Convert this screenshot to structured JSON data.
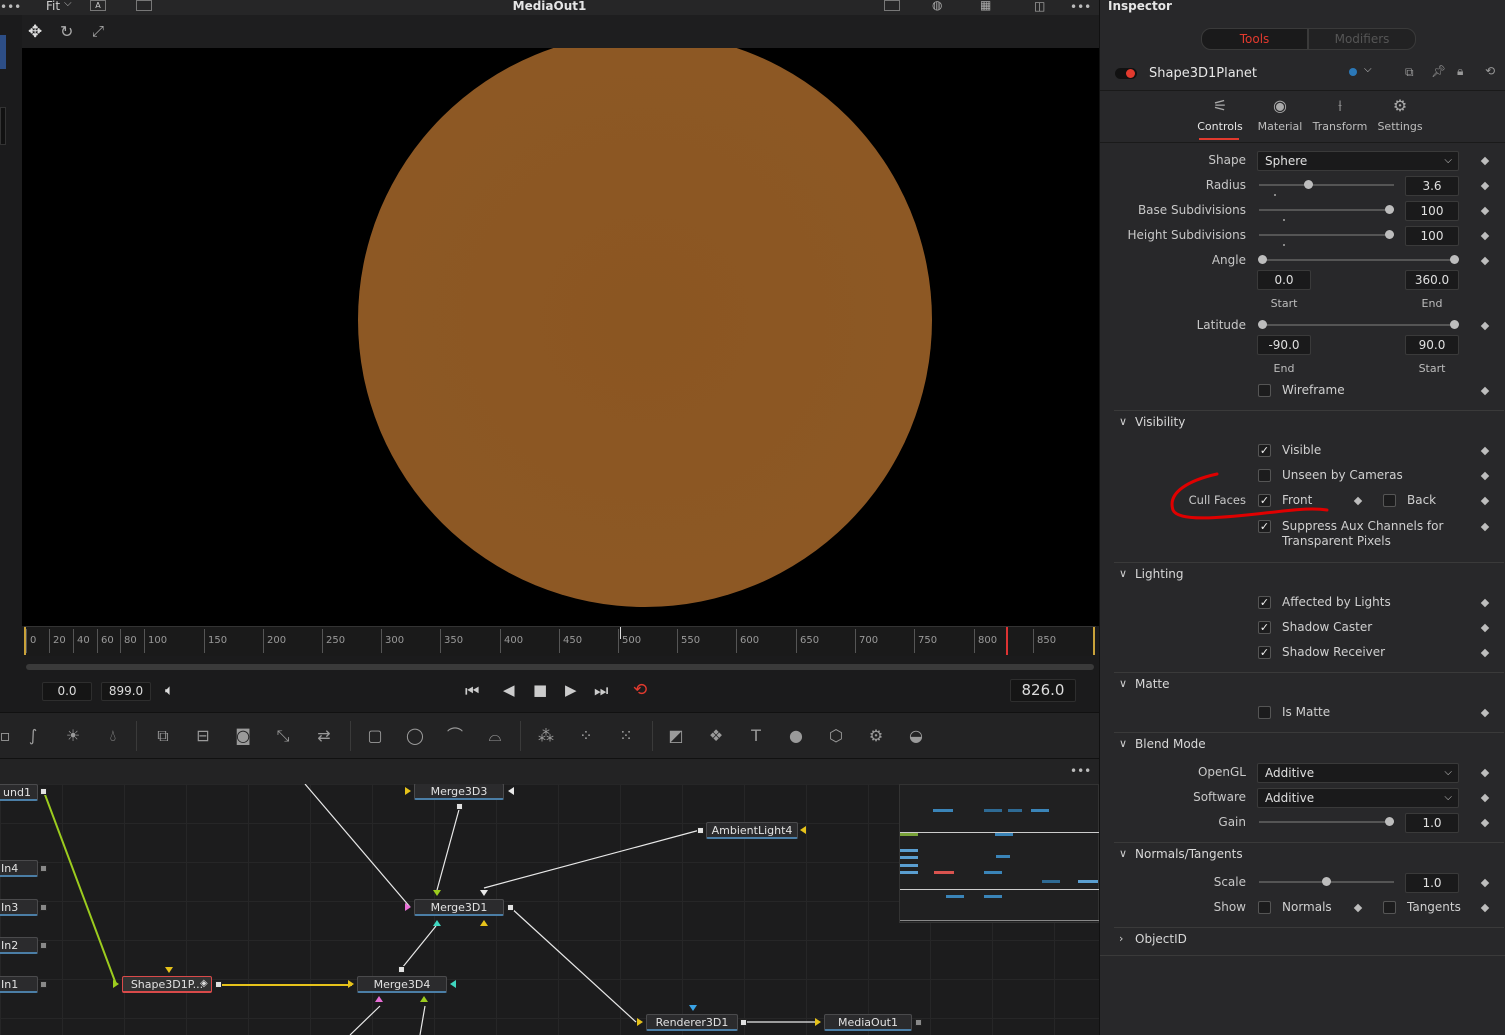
{
  "viewer": {
    "title": "MediaOut1",
    "fit_label": "Fit",
    "ruler_ticks": [
      "0",
      "20",
      "40",
      "60",
      "80",
      "100",
      "150",
      "200",
      "250",
      "300",
      "350",
      "400",
      "450",
      "500",
      "550",
      "600",
      "650",
      "700",
      "750",
      "800",
      "850"
    ],
    "start_frame": "0.0",
    "end_frame": "899.0",
    "current_frame": "826.0"
  },
  "nodes": {
    "items": [
      "und1",
      "In4",
      "In3",
      "In2",
      "In1",
      "Merge3D3",
      "Merge3D1",
      "AmbientLight4",
      "Shape3D1P...",
      "Merge3D4",
      "Renderer3D1",
      "MediaOut1"
    ]
  },
  "inspector": {
    "title": "Inspector",
    "tab_tools": "Tools",
    "tab_modifiers": "Modifiers",
    "tool_name": "Shape3D1Planet",
    "subtabs": [
      "Controls",
      "Material",
      "Transform",
      "Settings"
    ],
    "controls": {
      "shape_label": "Shape",
      "shape_value": "Sphere",
      "radius_label": "Radius",
      "radius_value": "3.6",
      "base_sub_label": "Base Subdivisions",
      "base_sub_value": "100",
      "height_sub_label": "Height Subdivisions",
      "height_sub_value": "100",
      "angle_label": "Angle",
      "angle_start": "0.0",
      "angle_end": "360.0",
      "angle_start_label": "Start",
      "angle_end_label": "End",
      "latitude_label": "Latitude",
      "lat_start": "-90.0",
      "lat_end": "90.0",
      "lat_start_label": "End",
      "lat_end_label": "Start",
      "wireframe_label": "Wireframe"
    },
    "visibility": {
      "title": "Visibility",
      "visible": "Visible",
      "unseen": "Unseen by Cameras",
      "cull_faces": "Cull Faces",
      "front": "Front",
      "back": "Back",
      "suppress_1": "Suppress Aux Channels for",
      "suppress_2": "Transparent Pixels"
    },
    "lighting": {
      "title": "Lighting",
      "affected": "Affected by Lights",
      "caster": "Shadow Caster",
      "receiver": "Shadow Receiver"
    },
    "matte": {
      "title": "Matte",
      "is_matte": "Is Matte"
    },
    "blend": {
      "title": "Blend Mode",
      "opengl_label": "OpenGL",
      "opengl_value": "Additive",
      "software_label": "Software",
      "software_value": "Additive",
      "gain_label": "Gain",
      "gain_value": "1.0"
    },
    "normals": {
      "title": "Normals/Tangents",
      "scale_label": "Scale",
      "scale_value": "1.0",
      "show_label": "Show",
      "normals": "Normals",
      "tangents": "Tangents"
    },
    "objectid": {
      "title": "ObjectID"
    }
  },
  "colors": {
    "planet": "#8d5824",
    "accent_red": "#e23a2e",
    "annotation_red": "#e00000",
    "node_link_yellow": "#e6c21a",
    "node_link_green": "#9ccc1e"
  }
}
